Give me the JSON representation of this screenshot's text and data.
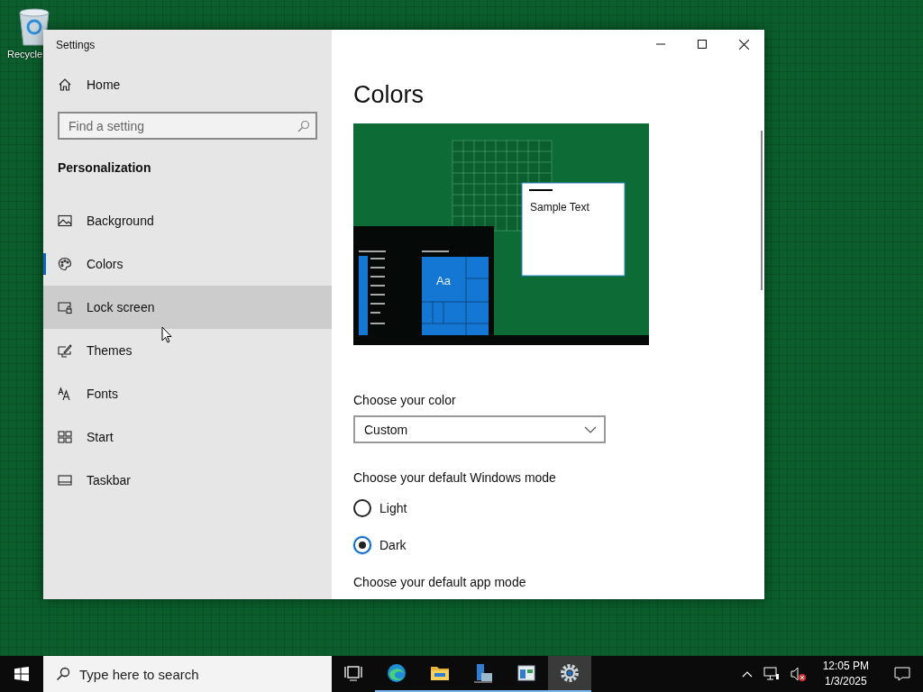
{
  "desktop": {
    "icons": [
      {
        "label": "Recycle"
      }
    ]
  },
  "window": {
    "title": "Settings",
    "sidebar": {
      "home": "Home",
      "search": {
        "placeholder": "Find a setting"
      },
      "section": "Personalization",
      "items": [
        {
          "label": "Background",
          "kind": "background",
          "selected": false,
          "hovered": false
        },
        {
          "label": "Colors",
          "kind": "colors",
          "selected": true,
          "hovered": false
        },
        {
          "label": "Lock screen",
          "kind": "lock",
          "selected": false,
          "hovered": true
        },
        {
          "label": "Themes",
          "kind": "themes",
          "selected": false,
          "hovered": false
        },
        {
          "label": "Fonts",
          "kind": "fonts",
          "selected": false,
          "hovered": false
        },
        {
          "label": "Start",
          "kind": "start",
          "selected": false,
          "hovered": false
        },
        {
          "label": "Taskbar",
          "kind": "taskbar",
          "selected": false,
          "hovered": false
        }
      ]
    },
    "content": {
      "heading": "Colors",
      "preview": {
        "sample_text": "Sample Text",
        "tile_text": "Aa"
      },
      "color_label": "Choose your color",
      "color_value": "Custom",
      "mode_label": "Choose your default Windows mode",
      "modes": [
        {
          "label": "Light",
          "selected": false
        },
        {
          "label": "Dark",
          "selected": true
        }
      ],
      "app_mode_label": "Choose your default app mode"
    }
  },
  "taskbar": {
    "search": {
      "placeholder": "Type here to search"
    },
    "apps": [
      {
        "kind": "taskview",
        "running": false,
        "active": false
      },
      {
        "kind": "edge",
        "running": true,
        "active": false
      },
      {
        "kind": "folder",
        "running": true,
        "active": false
      },
      {
        "kind": "server",
        "running": true,
        "active": false
      },
      {
        "kind": "panel",
        "running": true,
        "active": false
      },
      {
        "kind": "gear",
        "running": true,
        "active": true
      }
    ],
    "time": "12:05 PM",
    "date": "1/3/2025"
  }
}
